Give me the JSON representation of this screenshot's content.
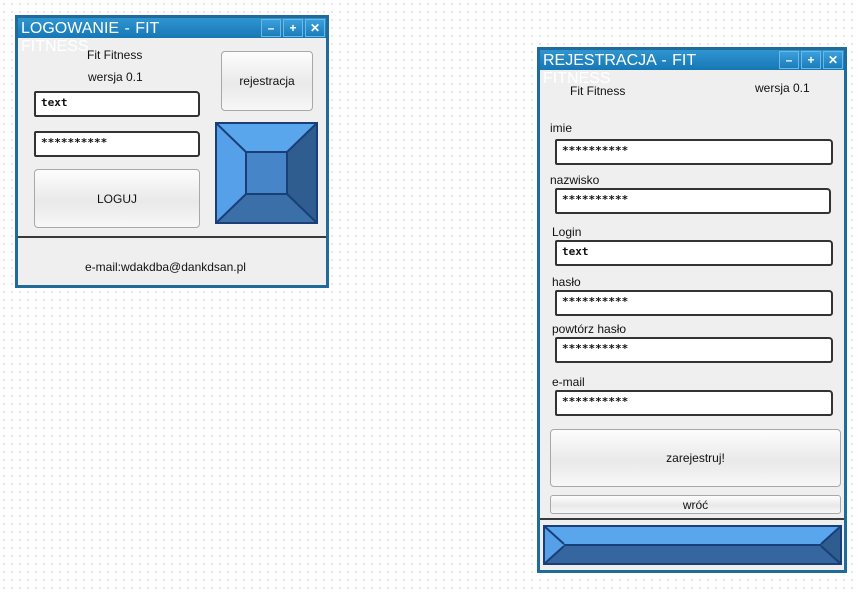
{
  "login_window": {
    "title": "LOGOWANIE - FIT FITNESS",
    "controls": {
      "minimize": "–",
      "maximize": "+",
      "close": "✕"
    },
    "app_name": "Fit Fitness",
    "version": "wersja 0.1",
    "register_button": "rejestracja",
    "login_field_value": "text",
    "password_field_value": "**********",
    "login_button": "LOGUJ",
    "contact_email": "e-mail:wdakdba@dankdsan.pl"
  },
  "register_window": {
    "title": "REJESTRACJA - FIT FITNESS",
    "controls": {
      "minimize": "–",
      "maximize": "+",
      "close": "✕"
    },
    "app_name": "Fit Fitness",
    "version": "wersja 0.1",
    "fields": [
      {
        "label": "imie",
        "value": "**********"
      },
      {
        "label": "nazwisko",
        "value": "**********"
      },
      {
        "label": "Login",
        "value": "text"
      },
      {
        "label": "hasło",
        "value": "**********"
      },
      {
        "label": "powtórz hasło",
        "value": "**********"
      },
      {
        "label": "e-mail",
        "value": "**********"
      }
    ],
    "submit_button": "zarejestruj!",
    "back_button": "wróć"
  },
  "colors": {
    "window_border": "#1f6b9a",
    "titlebar": "#1677b4",
    "image_placeholder": "#4a8fd4"
  }
}
